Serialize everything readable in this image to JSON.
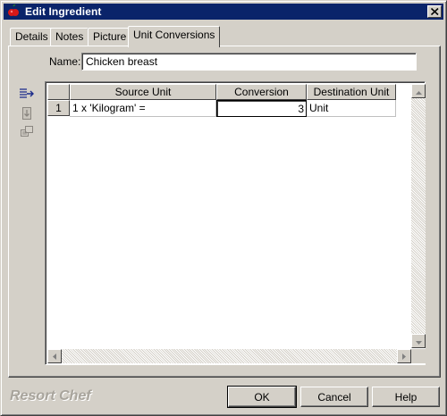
{
  "window": {
    "title": "Edit Ingredient"
  },
  "tabs": [
    {
      "label": "Details",
      "active": false
    },
    {
      "label": "Notes",
      "active": false
    },
    {
      "label": "Picture",
      "active": false
    },
    {
      "label": "Unit Conversions",
      "active": true
    }
  ],
  "name_field": {
    "label": "Name:",
    "value": "Chicken breast"
  },
  "side_tools": [
    "add-row-icon",
    "move-down-icon",
    "copy-icon"
  ],
  "grid": {
    "columns": [
      "Source Unit",
      "Conversion",
      "Destination Unit"
    ],
    "rows": [
      {
        "num": "1",
        "source": "1 x 'Kilogram' =",
        "conversion": "3",
        "destination": "Unit"
      }
    ]
  },
  "brand": "Resort Chef",
  "buttons": {
    "ok": "OK",
    "cancel": "Cancel",
    "help": "Help"
  },
  "colors": {
    "titlebar": "#0a246a",
    "face": "#d4d0c8",
    "brand_text": "#a8a49c"
  }
}
